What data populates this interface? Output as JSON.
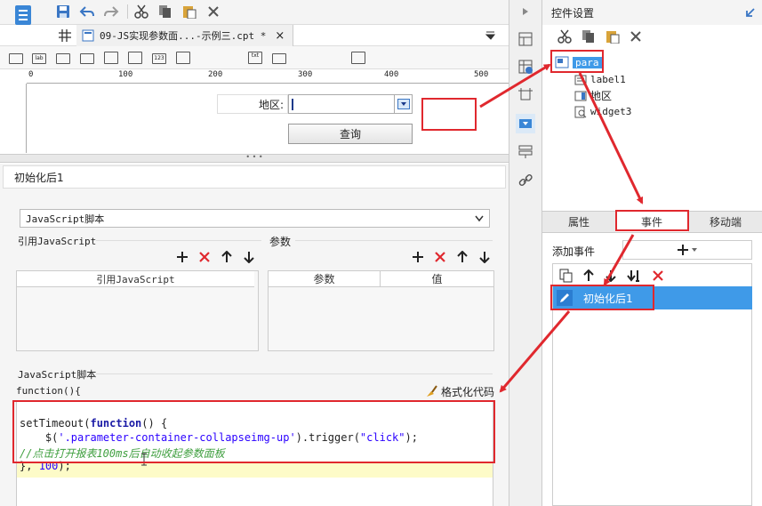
{
  "left": {
    "file_tab": "09-JS实现参数面...-示例三.cpt *",
    "ruler_ticks": [
      "0",
      "100",
      "200",
      "300",
      "400",
      "500"
    ],
    "param_label": "地区:",
    "query_button": "查询",
    "event_title": "初始化后1",
    "script_type": "JavaScript脚本",
    "ref_js_section": "引用JavaScript",
    "params_section": "参数",
    "ref_js_header": "引用JavaScript",
    "params_header_name": "参数",
    "params_header_value": "值",
    "js_script_label": "JavaScript脚本",
    "function_signature": "function(){",
    "format_code_label": "格式化代码",
    "code": {
      "line1_name": "setTimeout",
      "line1_paren": "(",
      "line1_kw": "function",
      "line1_rest": "() {",
      "line2_start": "    $(",
      "line2_str": "'.parameter-container-collapseimg-up'",
      "line2_mid": ").trigger(",
      "line2_str2": "\"click\"",
      "line2_end": ");",
      "line3_comment": "//点击打开报表100ms后自动收起参数面板",
      "line4_start": "}, ",
      "line4_num": "100",
      "line4_end": ");"
    }
  },
  "right": {
    "panel_title": "控件设置",
    "tree": {
      "root": "para",
      "children": [
        "label1",
        "地区",
        "widget3"
      ]
    },
    "tabs": [
      "属性",
      "事件",
      "移动端"
    ],
    "active_tab": "事件",
    "add_event_label": "添加事件",
    "event_item": "初始化后1"
  },
  "colors": {
    "annotation_red": "#e0282e",
    "selection_blue": "#3f9ae8",
    "code_keyword": "#1a1aa6",
    "code_string": "#2a00ff",
    "code_comment": "#3f9f3f",
    "active_line": "#fdfbc8"
  }
}
